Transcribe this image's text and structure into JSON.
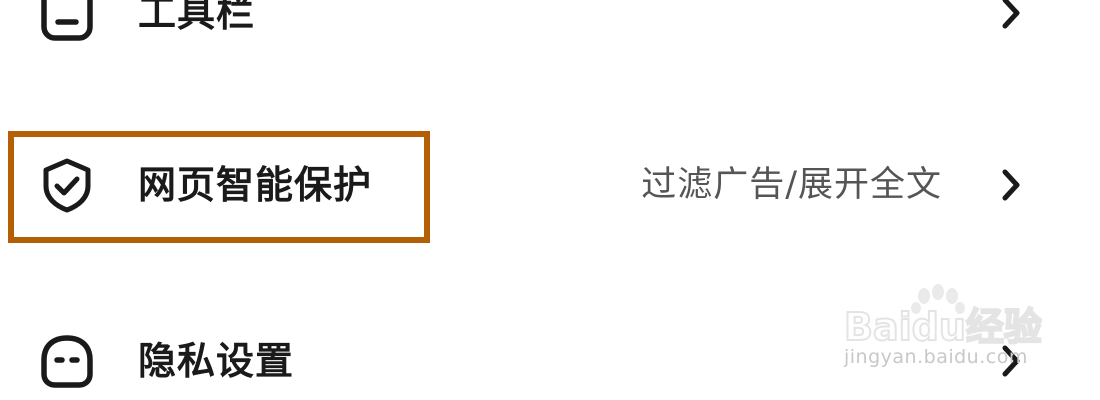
{
  "settings": {
    "items": [
      {
        "label": "工具栏",
        "value": "",
        "icon": "toolbar-icon"
      },
      {
        "label": "网页智能保护",
        "value": "过滤广告/展开全文",
        "icon": "shield-check-icon"
      },
      {
        "label": "隐私设置",
        "value": "",
        "icon": "privacy-face-icon"
      }
    ]
  },
  "watermark": {
    "brand": "Baidu经验",
    "url": "jingyan.baidu.com"
  },
  "colors": {
    "highlight": "#b45f06",
    "label": "#1a1a1a",
    "value": "#555555"
  }
}
